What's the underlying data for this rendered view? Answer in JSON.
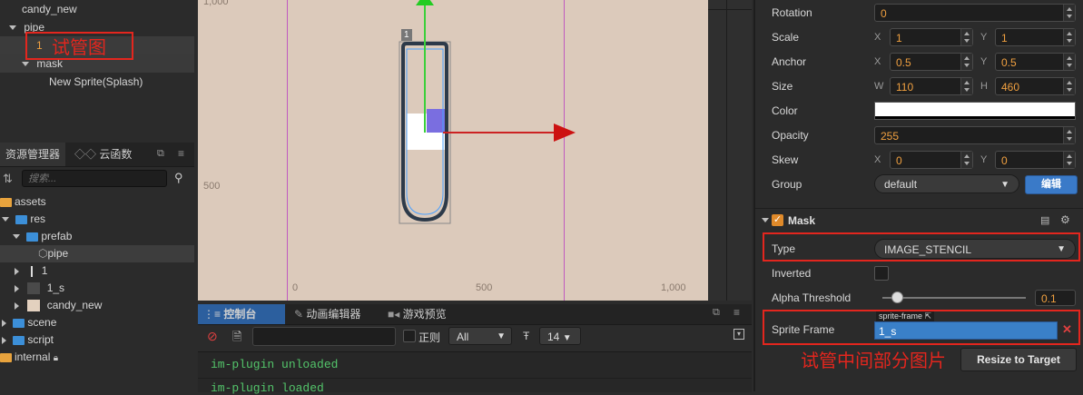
{
  "hierarchy": {
    "items": [
      {
        "label": "candy_new"
      },
      {
        "label": "pipe"
      },
      {
        "label": "1"
      },
      {
        "label": "mask"
      },
      {
        "label": "New Sprite(Splash)"
      }
    ],
    "annotation": "试管图"
  },
  "assets": {
    "tab_assets": "资源管理器",
    "tab_cloud": "云函数",
    "search_placeholder": "搜索...",
    "items": [
      {
        "label": "assets"
      },
      {
        "label": "res"
      },
      {
        "label": "prefab"
      },
      {
        "label": "pipe"
      },
      {
        "label": "1"
      },
      {
        "label": "1_s"
      },
      {
        "label": "candy_new"
      },
      {
        "label": "scene"
      },
      {
        "label": "script"
      },
      {
        "label": "internal"
      }
    ]
  },
  "scene": {
    "top_left_ruler": "1,000",
    "left_ruler_500": "500",
    "bottom_0": "0",
    "bottom_500": "500",
    "bottom_1000": "1,000",
    "node_badge": "1"
  },
  "console": {
    "tab_console": "控制台",
    "tab_anim": "动画编辑器",
    "tab_preview": "游戏预览",
    "regex_label": "正则",
    "level_value": "All",
    "font_size_value": "14",
    "log_lines": [
      "im-plugin unloaded",
      "im-plugin loaded"
    ]
  },
  "inspector": {
    "rotation_label": "Rotation",
    "rotation_value": "0",
    "scale_label": "Scale",
    "scale_x": "1",
    "scale_y": "1",
    "anchor_label": "Anchor",
    "anchor_x": "0.5",
    "anchor_y": "0.5",
    "size_label": "Size",
    "size_w": "110",
    "size_h": "460",
    "color_label": "Color",
    "opacity_label": "Opacity",
    "opacity_value": "255",
    "skew_label": "Skew",
    "skew_x": "0",
    "skew_y": "0",
    "group_label": "Group",
    "group_value": "default",
    "edit_button": "编辑",
    "x_letter": "X",
    "y_letter": "Y",
    "w_letter": "W",
    "h_letter": "H",
    "mask_title": "Mask",
    "type_label": "Type",
    "type_value": "IMAGE_STENCIL",
    "inverted_label": "Inverted",
    "alpha_label": "Alpha Threshold",
    "alpha_value": "0.1",
    "sprite_frame_label": "Sprite Frame",
    "sprite_frame_tag": "sprite-frame",
    "sprite_frame_value": "1_s",
    "resize_button": "Resize to Target",
    "annotation": "试管中间部分图片"
  },
  "colors": {
    "accent": "#3c8fd8",
    "annotation_red": "#e3261e",
    "value_orange": "#f0a040"
  }
}
